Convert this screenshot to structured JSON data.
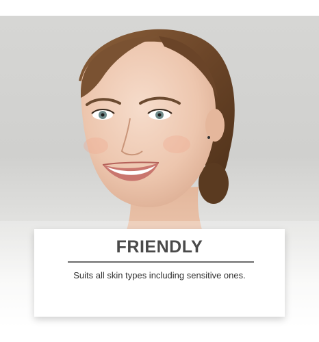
{
  "card": {
    "title": "FRIENDLY",
    "description": "Suits all skin types including sensitive ones."
  },
  "colors": {
    "background": "#d3d3d1",
    "card": "#ffffff",
    "title": "#4a4a4a",
    "divider": "#6b6b6b",
    "text": "#2f2f2f"
  }
}
